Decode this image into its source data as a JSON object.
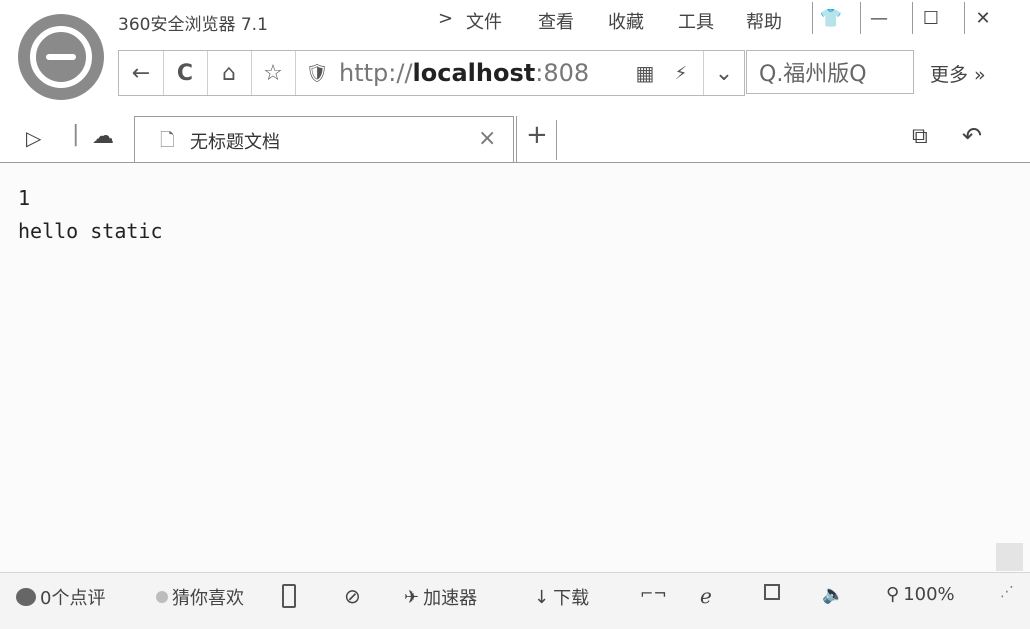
{
  "window": {
    "title": "360安全浏览器 7.1",
    "menu": [
      ">",
      "文件",
      "查看",
      "收藏",
      "工具",
      "帮助"
    ],
    "controls": {
      "skin": "👕",
      "minimize": "—",
      "maximize": "☐",
      "close": "✕"
    }
  },
  "nav": {
    "back": "←",
    "reload": "C",
    "home": "⌂",
    "favorite": "☆",
    "shield": "🛡",
    "url_prefix": "http://",
    "url_host": "localhost",
    "url_port": ":808",
    "qr": "▦",
    "lightning": "⚡",
    "dropdown": "⌄",
    "search": "Q.福州版Q",
    "more": "更多 »"
  },
  "tabs": {
    "left_icons": [
      "▷",
      "☁"
    ],
    "items": [
      {
        "title": "无标题文档",
        "close": "×"
      }
    ],
    "new_tab": "+",
    "right_icons": [
      "⧉",
      "↶"
    ]
  },
  "content": {
    "lines": [
      "1",
      "hello static"
    ]
  },
  "status": {
    "reviews": "0个点评",
    "guess": "猜你喜欢",
    "accelerator": "加速器",
    "download": "下载",
    "zoom": "100%"
  }
}
